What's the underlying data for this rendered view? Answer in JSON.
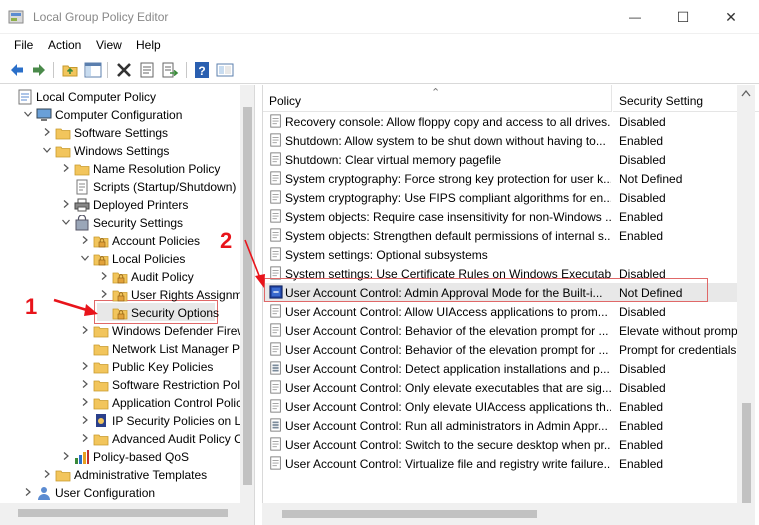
{
  "window": {
    "title": "Local Group Policy Editor",
    "minimize_glyph": "—",
    "maximize_glyph": "☐",
    "close_glyph": "✕"
  },
  "menu": [
    "File",
    "Action",
    "View",
    "Help"
  ],
  "toolbar": [
    "back-icon",
    "forward-icon",
    "up-folder-icon",
    "show-hide-tree-icon",
    "delete-icon",
    "properties-icon",
    "export-list-icon",
    "help-icon",
    "extended-view-icon"
  ],
  "tree": [
    {
      "label": "Local Computer Policy",
      "indent": 0,
      "arrow": "",
      "icon": "computer-policy"
    },
    {
      "label": "Computer Configuration",
      "indent": 1,
      "arrow": "down",
      "icon": "computer"
    },
    {
      "label": "Software Settings",
      "indent": 2,
      "arrow": "right",
      "icon": "folder"
    },
    {
      "label": "Windows Settings",
      "indent": 2,
      "arrow": "down",
      "icon": "folder"
    },
    {
      "label": "Name Resolution Policy",
      "indent": 3,
      "arrow": "right",
      "icon": "folder"
    },
    {
      "label": "Scripts (Startup/Shutdown)",
      "indent": 3,
      "arrow": "",
      "icon": "script"
    },
    {
      "label": "Deployed Printers",
      "indent": 3,
      "arrow": "right",
      "icon": "printer"
    },
    {
      "label": "Security Settings",
      "indent": 3,
      "arrow": "down",
      "icon": "security"
    },
    {
      "label": "Account Policies",
      "indent": 4,
      "arrow": "right",
      "icon": "lock-folder"
    },
    {
      "label": "Local Policies",
      "indent": 4,
      "arrow": "down",
      "icon": "lock-folder"
    },
    {
      "label": "Audit Policy",
      "indent": 5,
      "arrow": "right",
      "icon": "lock-folder"
    },
    {
      "label": "User Rights Assignme",
      "indent": 5,
      "arrow": "right",
      "icon": "lock-folder"
    },
    {
      "label": "Security Options",
      "indent": 5,
      "arrow": "",
      "icon": "lock-folder",
      "selected": true
    },
    {
      "label": "Windows Defender Firew",
      "indent": 4,
      "arrow": "right",
      "icon": "folder"
    },
    {
      "label": "Network List Manager Po",
      "indent": 4,
      "arrow": "",
      "icon": "folder"
    },
    {
      "label": "Public Key Policies",
      "indent": 4,
      "arrow": "right",
      "icon": "folder"
    },
    {
      "label": "Software Restriction Polic",
      "indent": 4,
      "arrow": "right",
      "icon": "folder"
    },
    {
      "label": "Application Control Polic",
      "indent": 4,
      "arrow": "right",
      "icon": "folder"
    },
    {
      "label": "IP Security Policies on Lo",
      "indent": 4,
      "arrow": "right",
      "icon": "ip-security"
    },
    {
      "label": "Advanced Audit Policy C",
      "indent": 4,
      "arrow": "right",
      "icon": "folder"
    },
    {
      "label": "Policy-based QoS",
      "indent": 3,
      "arrow": "right",
      "icon": "qos"
    },
    {
      "label": "Administrative Templates",
      "indent": 2,
      "arrow": "right",
      "icon": "folder"
    },
    {
      "label": "User Configuration",
      "indent": 1,
      "arrow": "right",
      "icon": "user"
    }
  ],
  "annotations": {
    "one": "1",
    "two": "2"
  },
  "columns": {
    "policy": "Policy",
    "setting": "Security Setting"
  },
  "policies": [
    {
      "name": "Recovery console: Allow floppy copy and access to all drives...",
      "value": "Disabled",
      "icon": "doc"
    },
    {
      "name": "Shutdown: Allow system to be shut down without having to...",
      "value": "Enabled",
      "icon": "doc"
    },
    {
      "name": "Shutdown: Clear virtual memory pagefile",
      "value": "Disabled",
      "icon": "doc"
    },
    {
      "name": "System cryptography: Force strong key protection for user k...",
      "value": "Not Defined",
      "icon": "doc"
    },
    {
      "name": "System cryptography: Use FIPS compliant algorithms for en...",
      "value": "Disabled",
      "icon": "doc"
    },
    {
      "name": "System objects: Require case insensitivity for non-Windows ...",
      "value": "Enabled",
      "icon": "doc"
    },
    {
      "name": "System objects: Strengthen default permissions of internal s...",
      "value": "Enabled",
      "icon": "doc"
    },
    {
      "name": "System settings: Optional subsystems",
      "value": "",
      "icon": "doc"
    },
    {
      "name": "System settings: Use Certificate Rules on Windows Executab...",
      "value": "Disabled",
      "icon": "doc"
    },
    {
      "name": "User Account Control: Admin Approval Mode for the Built-i...",
      "value": "Not Defined",
      "icon": "policy-active",
      "highlighted": true
    },
    {
      "name": "User Account Control: Allow UIAccess applications to prom...",
      "value": "Disabled",
      "icon": "doc"
    },
    {
      "name": "User Account Control: Behavior of the elevation prompt for ...",
      "value": "Elevate without promp",
      "icon": "doc"
    },
    {
      "name": "User Account Control: Behavior of the elevation prompt for ...",
      "value": "Prompt for credentials",
      "icon": "doc"
    },
    {
      "name": "User Account Control: Detect application installations and p...",
      "value": "Disabled",
      "icon": "doc-list"
    },
    {
      "name": "User Account Control: Only elevate executables that are sig...",
      "value": "Disabled",
      "icon": "doc"
    },
    {
      "name": "User Account Control: Only elevate UIAccess applications th...",
      "value": "Enabled",
      "icon": "doc"
    },
    {
      "name": "User Account Control: Run all administrators in Admin Appr...",
      "value": "Enabled",
      "icon": "doc-list"
    },
    {
      "name": "User Account Control: Switch to the secure desktop when pr...",
      "value": "Enabled",
      "icon": "doc"
    },
    {
      "name": "User Account Control: Virtualize file and registry write failure...",
      "value": "Enabled",
      "icon": "doc"
    }
  ],
  "colors": {
    "annotation_red": "#e8141b",
    "selection_gray": "#e8e8e8",
    "folder_yellow": "#f2c55c",
    "toolbar_blue": "#2a6fc9"
  }
}
